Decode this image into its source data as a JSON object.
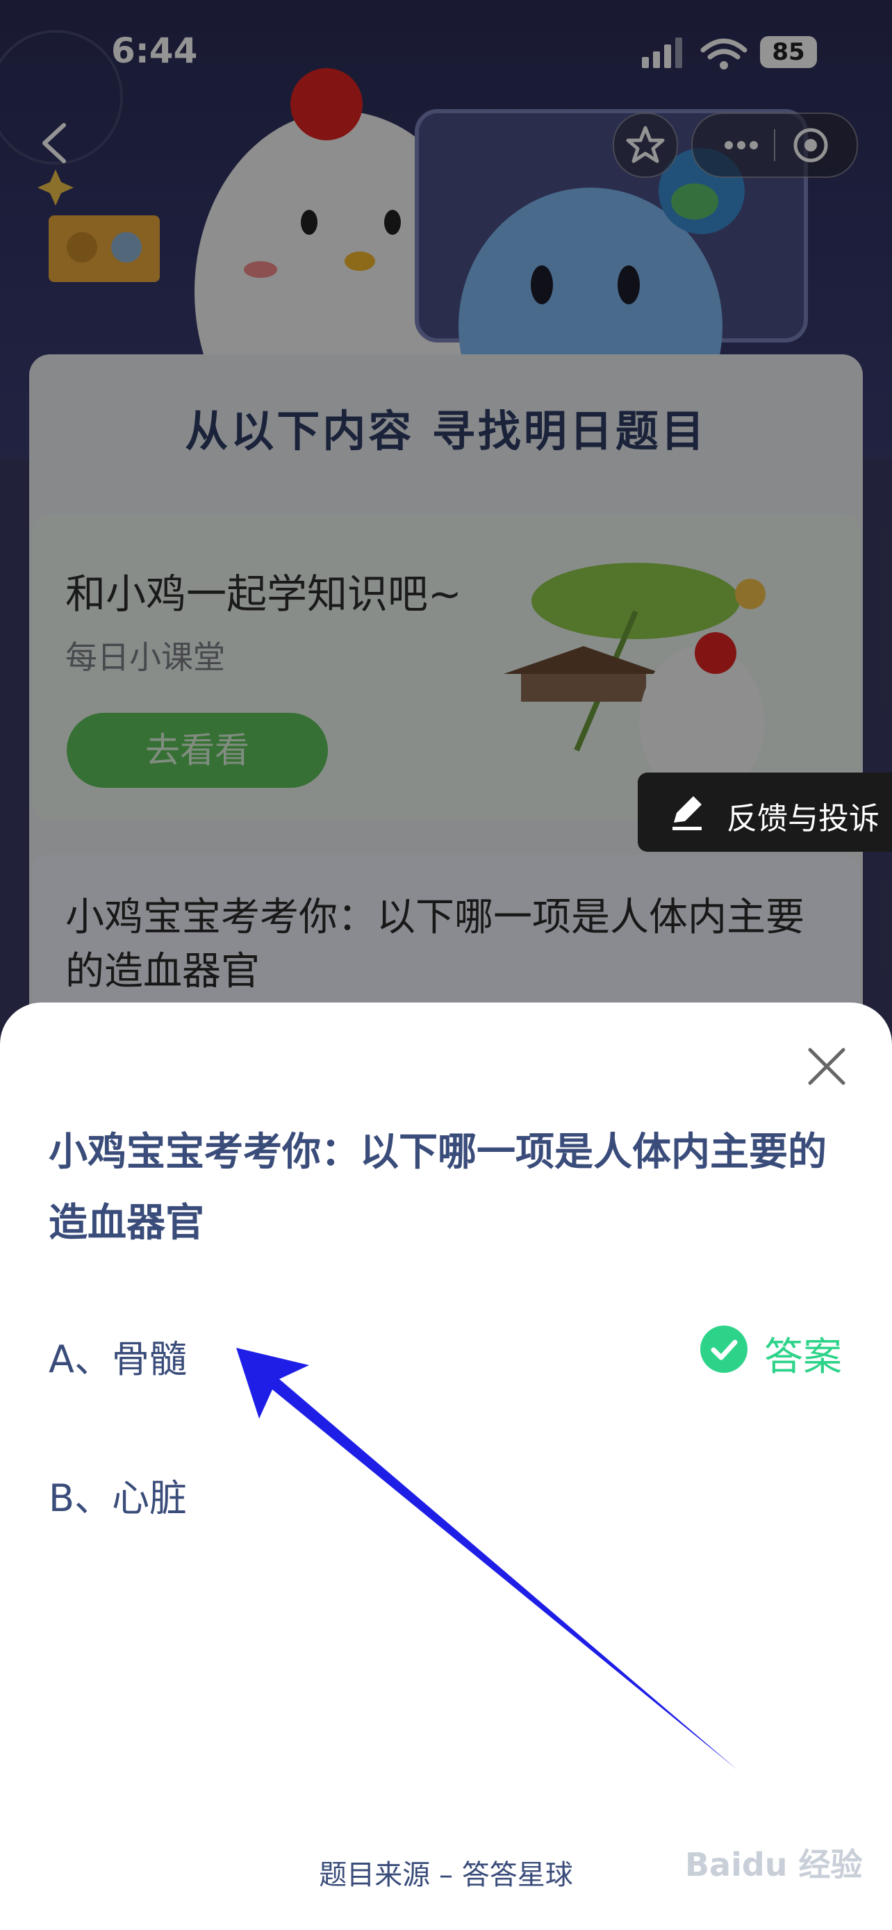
{
  "status_bar": {
    "time": "6:44",
    "battery": "85"
  },
  "background_page": {
    "section_title": "从以下内容 寻找明日题目",
    "lesson": {
      "title": "和小鸡一起学知识吧~",
      "subtitle": "每日小课堂",
      "button_label": "去看看"
    },
    "quiz_preview": "小鸡宝宝考考你：以下哪一项是人体内主要的造血器官",
    "feedback_label": "反馈与投诉"
  },
  "sheet": {
    "question": "小鸡宝宝考考你：以下哪一项是人体内主要的造血器官",
    "options": [
      {
        "label": "A、骨髓"
      },
      {
        "label": "B、心脏"
      }
    ],
    "answer_label": "答案",
    "source": "题目来源 – 答答星球"
  },
  "watermark": "Baidu 经验",
  "colors": {
    "accent_green": "#2ed38a",
    "question_text": "#3a4c7a",
    "arrow": "#1e1ee6"
  }
}
